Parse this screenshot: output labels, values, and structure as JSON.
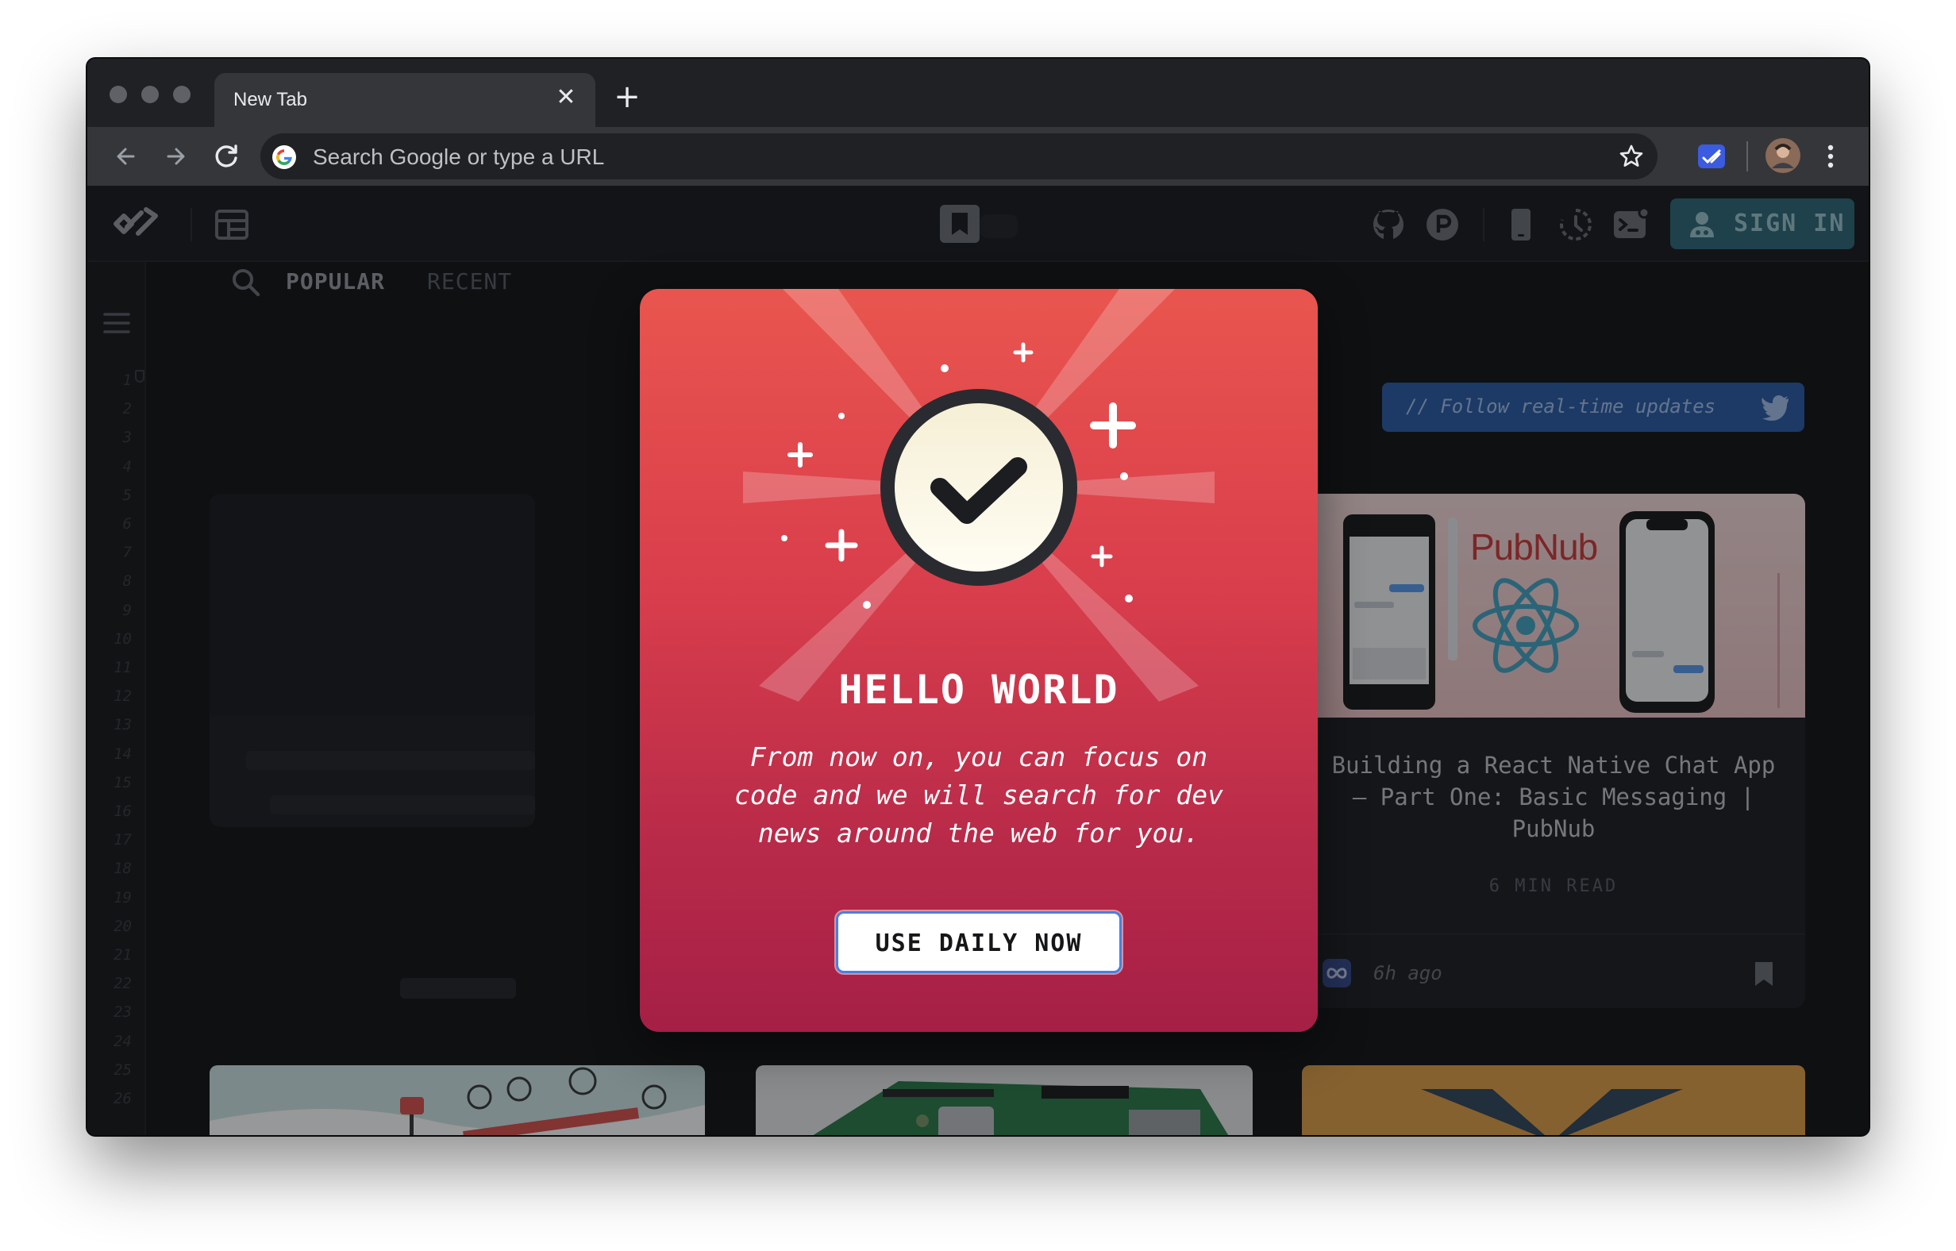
{
  "browser": {
    "tab_title": "New Tab",
    "omnibox_placeholder": "Search Google or type a URL"
  },
  "app": {
    "sign_in_label": "SIGN IN",
    "filters": [
      "POPULAR",
      "RECENT"
    ],
    "follow_label": "// Follow real-time updates",
    "line_numbers": [
      "1",
      "2",
      "3",
      "4",
      "5",
      "6",
      "7",
      "8",
      "9",
      "10",
      "11",
      "12",
      "13",
      "14",
      "15",
      "16",
      "17",
      "18",
      "19",
      "20",
      "21",
      "22",
      "23",
      "24",
      "25",
      "26"
    ],
    "card": {
      "title": "Building a React Native Chat App — Part One: Basic Messaging | PubNub",
      "read_time": "6 MIN READ",
      "time_ago": "6h ago",
      "brand_text": "PubNub"
    }
  },
  "modal": {
    "title": "HELLO WORLD",
    "text": "From now on, you can focus on code and we will search for dev news around the web for you.",
    "button_label": "USE DAILY NOW"
  },
  "colors": {
    "modal_top": "#e9554e",
    "modal_bottom": "#a51f46",
    "sign_in": "#2f6a7a",
    "follow": "#2d5ea7"
  },
  "icons": [
    "back-icon",
    "forward-icon",
    "reload-icon",
    "google-icon",
    "star-icon",
    "daily-extension-icon",
    "profile-avatar",
    "more-icon",
    "daily-logo-icon",
    "layout-icon",
    "bookmark-toggle-icon",
    "github-icon",
    "product-hunt-icon",
    "mobile-icon",
    "history-icon",
    "terminal-icon",
    "user-icon",
    "search-icon",
    "twitter-icon",
    "checkmark-icon",
    "menu-icon",
    "bookmark-icon",
    "source-icon"
  ]
}
